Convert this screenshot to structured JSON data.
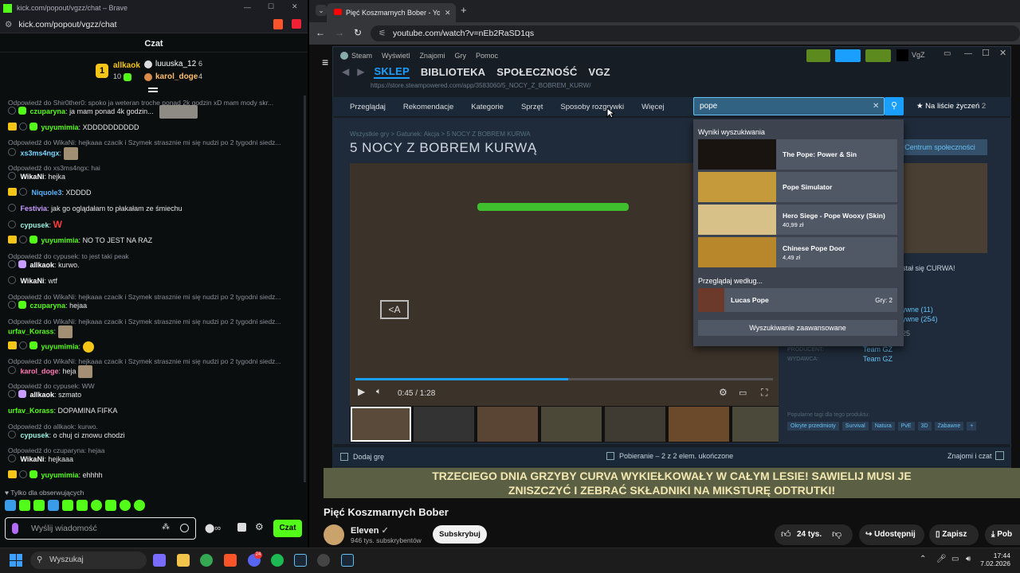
{
  "kick": {
    "window_title": "kick.com/popout/vgzz/chat – Brave",
    "address": "kick.com/popout/vgzz/chat",
    "chat_header": "Czat",
    "leaderboard": [
      {
        "rank": "1",
        "name": "allkaok",
        "count": "10"
      },
      {
        "name": "luuuska_12",
        "count": "6"
      },
      {
        "name": "karol_doge",
        "count": "4"
      }
    ],
    "messages": [
      {
        "reply": "Odpowiedź do Shir0ther0: spoko ja weteran troche ponad 2k godzin xD mam mody skr...",
        "user": "czuparyna",
        "text": "ja mam ponad 4k godzin..."
      },
      {
        "user": "yuyumimia",
        "text": "XDDDDDDDDDD"
      },
      {
        "reply": "Odpowiedź do WikaNi: hejkaaa czacik i Szymek strasznie mi się nudzi po 2 tygodni siedz...",
        "user": "xs3ms4ngx",
        "text": ""
      },
      {
        "reply": "Odpowiedź do xs3ms4ngx: hai",
        "user": "WikaNi",
        "text": "hejka"
      },
      {
        "user": "Niquole3",
        "text": "XDDDD"
      },
      {
        "user": "Festivia",
        "text": "jak go oglądałam to płakałam ze śmiechu"
      },
      {
        "user": "cypusek",
        "text": "W"
      },
      {
        "user": "yuyumimia",
        "text": "NO TO JEST NA RAZ"
      },
      {
        "reply": "Odpowiedź do cypusek: to jest taki peak",
        "user": "allkaok",
        "text": "kurwo."
      },
      {
        "user": "WikaNi",
        "text": "wtf"
      },
      {
        "reply": "Odpowiedź do WikaNi: hejkaaa czacik i Szymek strasznie mi się nudzi po 2 tygodni siedz...",
        "user": "czuparyna",
        "text": "hejaa"
      },
      {
        "reply": "Odpowiedź do WikaNi: hejkaaa czacik i Szymek strasznie mi się nudzi po 2 tygodni siedz...",
        "user": "urfav_Korass",
        "text": ""
      },
      {
        "user": "yuyumimia",
        "text": ""
      },
      {
        "reply": "Odpowiedź do WikaNi: hejkaaa czacik i Szymek strasznie mi się nudzi po 2 tygodni siedz...",
        "user": "karol_doge",
        "text": "heja"
      },
      {
        "reply": "Odpowiedź do cypusek: WW",
        "user": "allkaok",
        "text": "szmato"
      },
      {
        "user": "urfav_Korass",
        "text": "DOPAMINA FIFKA"
      },
      {
        "reply": "Odpowiedź do allkaok: kurwo.",
        "user": "cypusek",
        "text": "o chuj ci znowu chodzi"
      },
      {
        "reply": "Odpowiedź do czuparyna: hejaa",
        "user": "WikaNi",
        "text": "hejkaaa"
      },
      {
        "user": "yuyumimia",
        "text": "ehhhh"
      }
    ],
    "followers_only": "Tylko dla obserwujących",
    "input_placeholder": "Wyślij wiadomość",
    "send_label": "Czat"
  },
  "browser": {
    "tab_title": "Pięć Koszmarnych Bober - YouTube",
    "url": "youtube.com/watch?v=nEb2RaSD1qs"
  },
  "steam": {
    "menu": [
      "Steam",
      "Wyświetl",
      "Znajomi",
      "Gry",
      "Pomoc"
    ],
    "tabs": [
      "SKLEP",
      "BIBLIOTEKA",
      "SPOŁECZNOŚĆ",
      "VGZ"
    ],
    "user_label": "VgZ",
    "store_url": "https://store.steampowered.com/app/3583060/5_NOCY_Z_BOBREM_KURW/",
    "nav": [
      "Przeglądaj",
      "Rekomendacje",
      "Kategorie",
      "Sprzęt",
      "Sposoby rozgrywki",
      "Więcej"
    ],
    "search_value": "pope",
    "wishlist": "Na liście życzeń",
    "wishlist_count": "2",
    "breadcrumb": "Wszystkie gry > Gatunek: Akcja > 5 NOCY Z BOBREM KURWA",
    "game_title": "5 NOCY Z BOBREM KURWĄ",
    "community_btn": "Centrum społeczności",
    "video_time": "0:45 / 1:28",
    "dropdown": {
      "header": "Wyniki wyszukiwania",
      "results": [
        {
          "title": "The Pope: Power & Sin",
          "price": ""
        },
        {
          "title": "Pope Simulator",
          "price": ""
        },
        {
          "title": "Hero Siege - Pope Wooxy (Skin)",
          "price": "40,99 zł"
        },
        {
          "title": "Chinese Pope Door",
          "price": "4,49 zł"
        }
      ],
      "browse_header": "Przeglądaj według...",
      "browse_item": "Lucas Pope",
      "browse_count": "Gry: 2",
      "advanced": "Wyszukiwanie zaawansowane"
    },
    "side_text": "stał się CURWA!",
    "side_reviews_1": "ywne (11)",
    "side_reviews_2": "ywne (254)",
    "side_num": "25",
    "producer_label": "PRODUCENT:",
    "producer": "Team GZ",
    "publisher_label": "WYDAWCA:",
    "publisher": "Team GZ",
    "tags_header": "Popularne tagi dla tego produktu:",
    "tags": [
      "Okryte przedmioty",
      "Survival",
      "Natura",
      "PvE",
      "3D",
      "Zabawne",
      "+"
    ],
    "add_game": "Dodaj grę",
    "downloads": "Pobieranie – 2 z 2 elem. ukończone",
    "friends": "Znajomi i czat"
  },
  "youtube": {
    "subtitle_1": "TRZECIEGO DNIA GRZYBY CURVA WYKIEŁKOWAŁY W CAŁYM LESIE! SAWIELIJ MUSI JE",
    "subtitle_2": "ZNISZCZYĆ I ZEBRAĆ SKŁADNIKI NA MIKSTURĘ ODTRUTKI!",
    "title": "Pięć Koszmarnych Bober",
    "channel": "Eleven",
    "subs": "946 tys. subskrybentów",
    "subscribe": "Subskrybuj",
    "likes": "24 tys.",
    "share": "Udostępnij",
    "save": "Zapisz",
    "download": "Pob"
  },
  "taskbar": {
    "search": "Wyszukaj",
    "time": "17:44",
    "date": "7.02.2026",
    "badge": "24"
  }
}
